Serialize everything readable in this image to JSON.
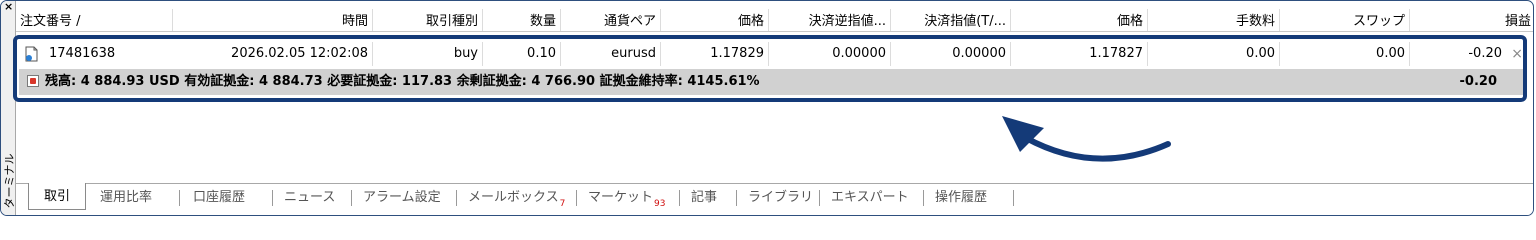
{
  "window": {
    "close_glyph": "×",
    "side_label": "ターミナル"
  },
  "columns": [
    "注文番号 /",
    "時間",
    "取引種別",
    "数量",
    "通貨ペア",
    "価格",
    "決済逆指値...",
    "決済指値(T/...",
    "価格",
    "手数料",
    "スワップ",
    "損益"
  ],
  "order": {
    "ticket": "17481638",
    "time": "2026.02.05 12:02:08",
    "type": "buy",
    "volume": "0.10",
    "symbol": "eurusd",
    "open_price": "1.17829",
    "stop_loss": "0.00000",
    "take_profit": "0.00000",
    "current_price": "1.17827",
    "commission": "0.00",
    "swap": "0.00",
    "profit": "-0.20",
    "close_glyph": "×"
  },
  "balance": {
    "summary": "残高: 4 884.93 USD 有効証拠金: 4 884.73 必要証拠金: 117.83 余剰証拠金: 4 766.90 証拠金維持率: 4145.61%",
    "profit": "-0.20"
  },
  "tabs": [
    {
      "label": "取引",
      "badge": "",
      "active": true
    },
    {
      "label": "運用比率",
      "badge": "",
      "active": false
    },
    {
      "label": "口座履歴",
      "badge": "",
      "active": false
    },
    {
      "label": "ニュース",
      "badge": "",
      "active": false
    },
    {
      "label": "アラーム設定",
      "badge": "",
      "active": false
    },
    {
      "label": "メールボックス",
      "badge": "7",
      "active": false
    },
    {
      "label": "マーケット",
      "badge": "93",
      "active": false
    },
    {
      "label": "記事",
      "badge": "",
      "active": false
    },
    {
      "label": "ライブラリ",
      "badge": "",
      "active": false
    },
    {
      "label": "エキスパート",
      "badge": "",
      "active": false
    },
    {
      "label": "操作履歴",
      "badge": "",
      "active": false
    }
  ],
  "colors": {
    "highlight": "#143a78",
    "balance_row": "#d1d1d1",
    "badge": "#d01010"
  },
  "icons": {
    "order_icon": "document-icon",
    "balance_icon": "down-arrow-icon",
    "annotation": "curved-arrow-icon"
  }
}
